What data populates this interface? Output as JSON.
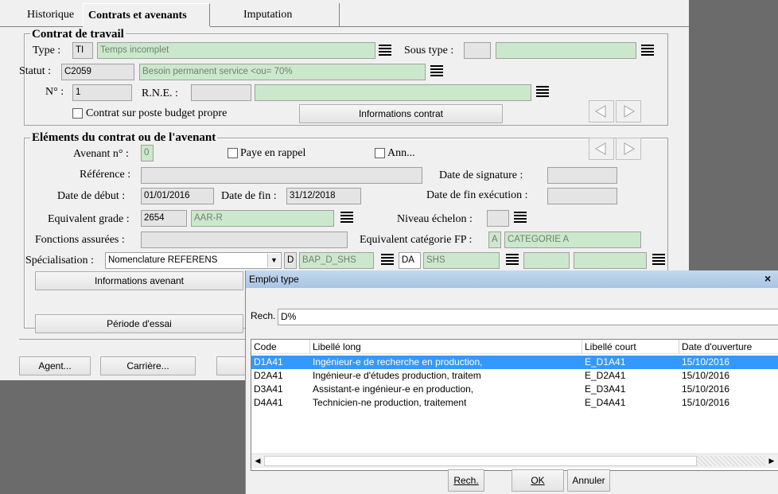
{
  "tabs": [
    "Historique",
    "Contrats et avenants",
    "Imputation"
  ],
  "contrat": {
    "title": "Contrat de travail",
    "type_label": "Type :",
    "type_code": "TI",
    "type_value": "Temps incomplet",
    "sous_type_label": "Sous type :",
    "statut_label": "Statut :",
    "statut_code": "C2059",
    "statut_value": "Besoin permanent service <ou= 70%",
    "no_label": "N° :",
    "no_value": "1",
    "rne_label": "R.N.E. :",
    "budget_label": "Contrat sur poste budget propre",
    "info_button": "Informations contrat"
  },
  "avenant": {
    "title": "Eléments du contrat ou de l'avenant",
    "avenant_no_label": "Avenant n° :",
    "avenant_no_value": "0",
    "paye_label": "Paye en rappel",
    "ann_label": "Ann...",
    "reference_label": "Référence :",
    "date_signature_label": "Date de signature :",
    "date_debut_label": "Date de début :",
    "date_debut_value": "01/01/2016",
    "date_fin_label": "Date de fin :",
    "date_fin_value": "31/12/2018",
    "date_fin_exec_label": "Date de fin exécution :",
    "equiv_grade_label": "Equivalent grade :",
    "equiv_grade_code": "2654",
    "equiv_grade_value": "AAR-R",
    "niveau_label": "Niveau échelon :",
    "fonctions_label": "Fonctions assurées :",
    "equiv_cat_label": "Equivalent catégorie FP :",
    "equiv_cat_code": "A",
    "equiv_cat_value": "CATEGORIE A",
    "specialisation_label": "Spécialisation :",
    "specialisation_value": "Nomenclature REFERENS",
    "spec_code1": "D",
    "spec_value1": "BAP_D_SHS",
    "spec_code2": "DA",
    "spec_value2": "SHS",
    "info_avenant_button": "Informations avenant",
    "periode_button": "Période d'essai"
  },
  "bottom_buttons": [
    "Agent...",
    "Carrière..."
  ],
  "dialog": {
    "title": "Emploi type",
    "close": "×",
    "search_label": "Rech.",
    "search_value": "D%",
    "columns": [
      "Code",
      "Libellé long",
      "Libellé court",
      "Date d'ouverture"
    ],
    "rows": [
      [
        "D1A41",
        "Ingénieur-e de recherche en production,",
        "E_D1A41",
        "15/10/2016"
      ],
      [
        "D2A41",
        "Ingénieur-e d'études production, traitem",
        "E_D2A41",
        "15/10/2016"
      ],
      [
        "D3A41",
        "Assistant-e ingénieur-e en production,",
        "E_D3A41",
        "15/10/2016"
      ],
      [
        "D4A41",
        "Technicien-ne production, traitement",
        "E_D4A41",
        "15/10/2016"
      ]
    ],
    "btn_rech": "Rech.",
    "btn_ok": "OK",
    "btn_annuler": "Annuler"
  }
}
